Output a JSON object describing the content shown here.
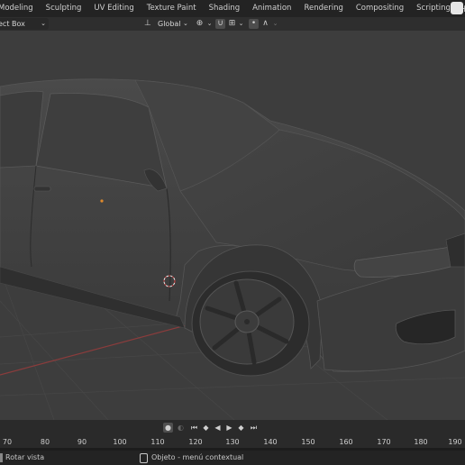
{
  "workspace_tabs": [
    "Modeling",
    "Sculpting",
    "UV Editing",
    "Texture Paint",
    "Shading",
    "Animation",
    "Rendering",
    "Compositing",
    "Scripting"
  ],
  "add_tab": "+",
  "header": {
    "select_mode": "ect Box",
    "transform_orientation": "Global"
  },
  "timeline_ruler": [
    "70",
    "80",
    "90",
    "100",
    "110",
    "120",
    "130",
    "140",
    "150",
    "160",
    "170",
    "180",
    "190"
  ],
  "status": {
    "left": "Rotar vista",
    "middle": "Objeto - menú contextual"
  }
}
